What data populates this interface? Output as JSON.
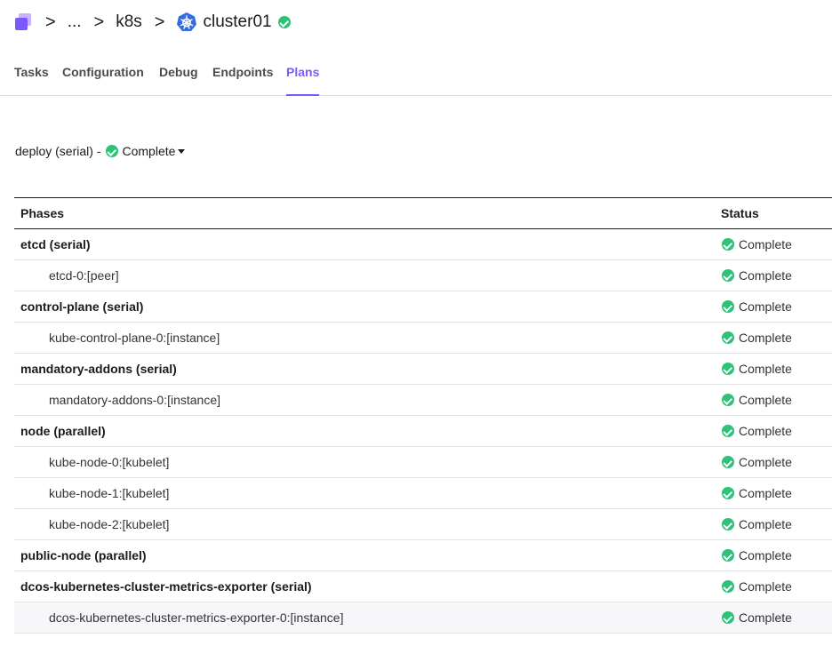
{
  "breadcrumb": {
    "ellipsis": "...",
    "parent": "k8s",
    "service": "cluster01",
    "separator": ">",
    "icons": [
      "app-logo-icon",
      "kubernetes-icon",
      "check-circle-icon"
    ]
  },
  "tabs": [
    {
      "label": "Tasks",
      "active": false
    },
    {
      "label": "Configuration",
      "active": false
    },
    {
      "label": "Debug",
      "active": false
    },
    {
      "label": "Endpoints",
      "active": false
    },
    {
      "label": "Plans",
      "active": true
    }
  ],
  "plan": {
    "name": "deploy (serial) -",
    "status": "Complete"
  },
  "table": {
    "headers": {
      "phases": "Phases",
      "status": "Status"
    },
    "rows": [
      {
        "label": "etcd (serial)",
        "kind": "phase",
        "status": "Complete"
      },
      {
        "label": "etcd-0:[peer]",
        "kind": "step",
        "status": "Complete"
      },
      {
        "label": "control-plane (serial)",
        "kind": "phase",
        "status": "Complete"
      },
      {
        "label": "kube-control-plane-0:[instance]",
        "kind": "step",
        "status": "Complete"
      },
      {
        "label": "mandatory-addons (serial)",
        "kind": "phase",
        "status": "Complete"
      },
      {
        "label": "mandatory-addons-0:[instance]",
        "kind": "step",
        "status": "Complete"
      },
      {
        "label": "node (parallel)",
        "kind": "phase",
        "status": "Complete"
      },
      {
        "label": "kube-node-0:[kubelet]",
        "kind": "step",
        "status": "Complete"
      },
      {
        "label": "kube-node-1:[kubelet]",
        "kind": "step",
        "status": "Complete"
      },
      {
        "label": "kube-node-2:[kubelet]",
        "kind": "step",
        "status": "Complete"
      },
      {
        "label": "public-node (parallel)",
        "kind": "phase",
        "status": "Complete"
      },
      {
        "label": "dcos-kubernetes-cluster-metrics-exporter (serial)",
        "kind": "phase",
        "status": "Complete"
      },
      {
        "label": "dcos-kubernetes-cluster-metrics-exporter-0:[instance]",
        "kind": "step",
        "status": "Complete",
        "highlighted": true
      }
    ]
  },
  "colors": {
    "accent": "#7d58ff",
    "success": "#2ec178",
    "kubernetes": "#326ce5"
  }
}
